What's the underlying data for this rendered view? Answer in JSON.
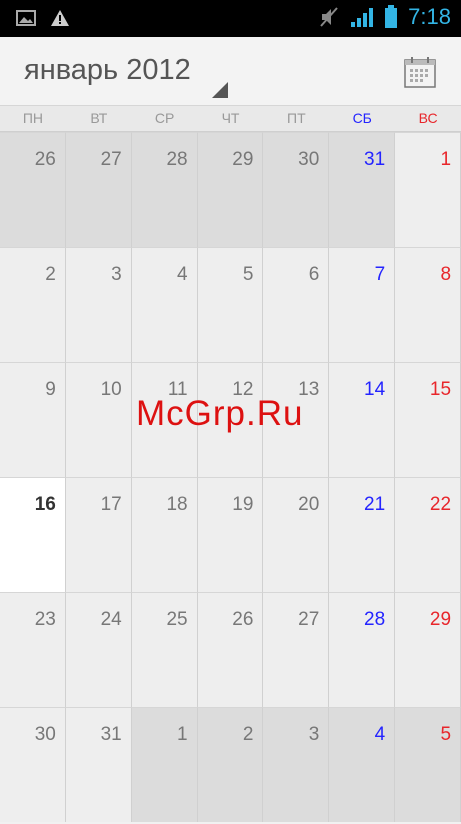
{
  "status_bar": {
    "time": "7:18",
    "icons": [
      "picture-icon",
      "warning-icon",
      "mute-icon",
      "signal-icon",
      "battery-icon"
    ]
  },
  "header": {
    "month_title": "январь 2012"
  },
  "weekdays": [
    "ПН",
    "ВТ",
    "СР",
    "ЧТ",
    "ПТ",
    "СБ",
    "ВС"
  ],
  "weeks": [
    [
      {
        "d": "26",
        "m": "prev"
      },
      {
        "d": "27",
        "m": "prev"
      },
      {
        "d": "28",
        "m": "prev"
      },
      {
        "d": "29",
        "m": "prev"
      },
      {
        "d": "30",
        "m": "prev"
      },
      {
        "d": "31",
        "m": "prev"
      },
      {
        "d": "1",
        "m": "cur"
      }
    ],
    [
      {
        "d": "2",
        "m": "cur"
      },
      {
        "d": "3",
        "m": "cur"
      },
      {
        "d": "4",
        "m": "cur"
      },
      {
        "d": "5",
        "m": "cur"
      },
      {
        "d": "6",
        "m": "cur"
      },
      {
        "d": "7",
        "m": "cur"
      },
      {
        "d": "8",
        "m": "cur"
      }
    ],
    [
      {
        "d": "9",
        "m": "cur"
      },
      {
        "d": "10",
        "m": "cur"
      },
      {
        "d": "11",
        "m": "cur"
      },
      {
        "d": "12",
        "m": "cur"
      },
      {
        "d": "13",
        "m": "cur"
      },
      {
        "d": "14",
        "m": "cur"
      },
      {
        "d": "15",
        "m": "cur"
      }
    ],
    [
      {
        "d": "16",
        "m": "today"
      },
      {
        "d": "17",
        "m": "cur"
      },
      {
        "d": "18",
        "m": "cur"
      },
      {
        "d": "19",
        "m": "cur"
      },
      {
        "d": "20",
        "m": "cur"
      },
      {
        "d": "21",
        "m": "cur"
      },
      {
        "d": "22",
        "m": "cur"
      }
    ],
    [
      {
        "d": "23",
        "m": "cur"
      },
      {
        "d": "24",
        "m": "cur"
      },
      {
        "d": "25",
        "m": "cur"
      },
      {
        "d": "26",
        "m": "cur"
      },
      {
        "d": "27",
        "m": "cur"
      },
      {
        "d": "28",
        "m": "cur"
      },
      {
        "d": "29",
        "m": "cur"
      }
    ],
    [
      {
        "d": "30",
        "m": "cur"
      },
      {
        "d": "31",
        "m": "cur"
      },
      {
        "d": "1",
        "m": "next"
      },
      {
        "d": "2",
        "m": "next"
      },
      {
        "d": "3",
        "m": "next"
      },
      {
        "d": "4",
        "m": "next"
      },
      {
        "d": "5",
        "m": "next"
      }
    ]
  ],
  "watermark": "McGrp.Ru",
  "colors": {
    "saturday": "#2424ff",
    "sunday": "#e8262b",
    "status_accent": "#33b5e5"
  }
}
